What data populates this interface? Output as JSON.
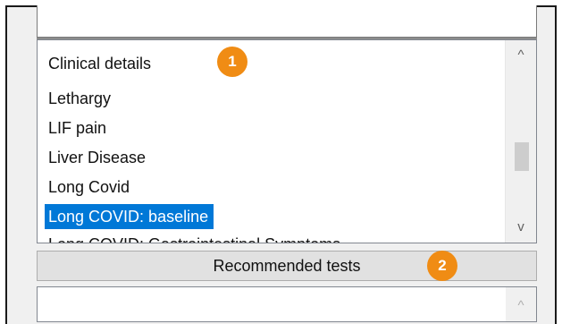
{
  "listbox": {
    "items": [
      {
        "label": "Clinical details"
      },
      {
        "label": "Lethargy"
      },
      {
        "label": "LIF pain"
      },
      {
        "label": "Liver Disease"
      },
      {
        "label": "Long Covid"
      },
      {
        "label": "Long COVID: baseline",
        "selected": true
      },
      {
        "label": "Long COVID: Gastrointestinal Symptoms"
      }
    ],
    "scroll_up": "^",
    "scroll_down": "v"
  },
  "recommended_button_label": "Recommended tests",
  "bottom_list": {
    "scroll_up": "^"
  },
  "callouts": [
    {
      "number": "1"
    },
    {
      "number": "2"
    }
  ],
  "colors": {
    "selection": "#0078d7",
    "callout": "#f08c14",
    "button_face": "#e1e1e1"
  }
}
